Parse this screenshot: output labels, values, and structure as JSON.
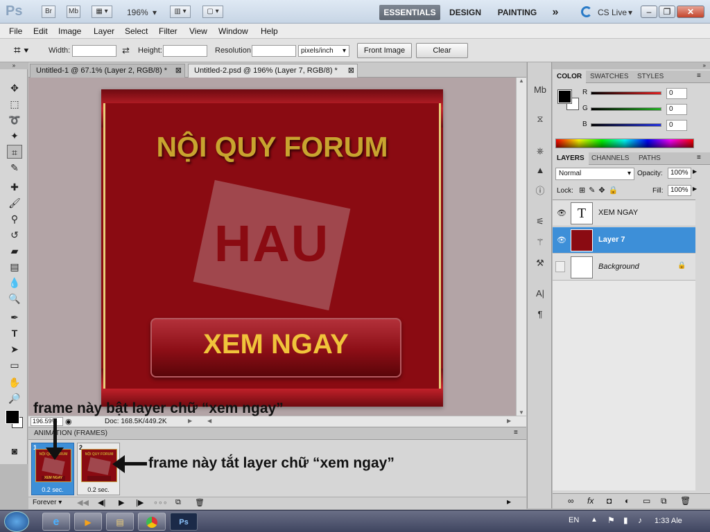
{
  "app": {
    "logo": "Ps",
    "top_buttons": [
      "Br",
      "Mb"
    ],
    "zoom_display": "196%",
    "workspaces": [
      "ESSENTIALS",
      "DESIGN",
      "PAINTING"
    ],
    "more_label": "»",
    "cs_live": "CS Live",
    "window_controls": [
      "–",
      "❐",
      "✕"
    ]
  },
  "menu": [
    "File",
    "Edit",
    "Image",
    "Layer",
    "Select",
    "Filter",
    "View",
    "Window",
    "Help"
  ],
  "options": {
    "width_label": "Width:",
    "width_value": "",
    "height_label": "Height:",
    "height_value": "",
    "resolution_label": "Resolution:",
    "resolution_value": "",
    "unit": "pixels/inch",
    "front_image": "Front Image",
    "clear": "Clear"
  },
  "tabs": [
    {
      "label": "Untitled-1 @ 67.1% (Layer 2, RGB/8) *",
      "active": false
    },
    {
      "label": "Untitled-2.psd @ 196% (Layer 7, RGB/8) *",
      "active": true
    }
  ],
  "artwork": {
    "title": "NỘI QUY FORUM",
    "logo": "HAU",
    "button": "XEM NGAY"
  },
  "status": {
    "zoom": "196.59%",
    "doc": "Doc: 168.5K/449.2K"
  },
  "animation": {
    "header": "ANIMATION (FRAMES)",
    "frames": [
      {
        "num": "1",
        "delay": "0.2 sec.",
        "selected": true
      },
      {
        "num": "2",
        "delay": "0.2 sec.",
        "selected": false
      }
    ],
    "loop": "Forever"
  },
  "annotations": {
    "top": "frame này bật layer chữ “xem ngay”",
    "right": "frame này tắt layer chữ “xem ngay”"
  },
  "color_panel": {
    "tabs": [
      "COLOR",
      "SWATCHES",
      "STYLES"
    ],
    "channels": [
      {
        "label": "R",
        "value": "0",
        "color": "#e02020"
      },
      {
        "label": "G",
        "value": "0",
        "color": "#20b020"
      },
      {
        "label": "B",
        "value": "0",
        "color": "#2030e0"
      }
    ]
  },
  "layers_panel": {
    "tabs": [
      "LAYERS",
      "CHANNELS",
      "PATHS"
    ],
    "blend_mode": "Normal",
    "opacity_label": "Opacity:",
    "opacity": "100%",
    "lock_label": "Lock:",
    "fill_label": "Fill:",
    "fill": "100%",
    "layers": [
      {
        "name": "XEM NGAY",
        "type": "text",
        "visible": true,
        "selected": false
      },
      {
        "name": "Layer 7",
        "type": "image",
        "visible": true,
        "selected": true
      },
      {
        "name": "Background",
        "type": "background",
        "visible": false,
        "selected": false
      }
    ]
  },
  "taskbar": {
    "lang": "EN",
    "time": "1:33 Ale",
    "apps": [
      "ie",
      "media",
      "explorer",
      "chrome",
      "Ps"
    ]
  },
  "colors": {
    "accent": "#3d8fd8",
    "artwork_red": "#8a0b12",
    "gold": "#d4a72c"
  }
}
